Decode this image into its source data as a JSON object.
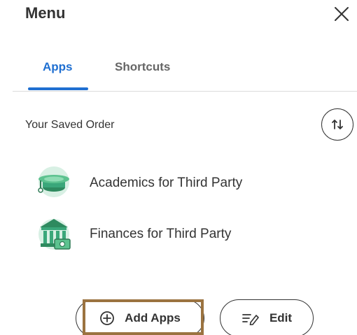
{
  "header": {
    "title": "Menu"
  },
  "tabs": [
    {
      "label": "Apps",
      "active": true
    },
    {
      "label": "Shortcuts",
      "active": false
    }
  ],
  "section": {
    "label": "Your Saved Order"
  },
  "apps": [
    {
      "label": "Academics for Third Party",
      "icon": "graduation-cap-icon"
    },
    {
      "label": "Finances for Third Party",
      "icon": "bank-icon"
    }
  ],
  "actions": {
    "add_apps_label": "Add Apps",
    "edit_label": "Edit"
  },
  "colors": {
    "accent": "#1f6fd1",
    "icon_green": "#3aa77a",
    "highlight": "#9b7340"
  }
}
